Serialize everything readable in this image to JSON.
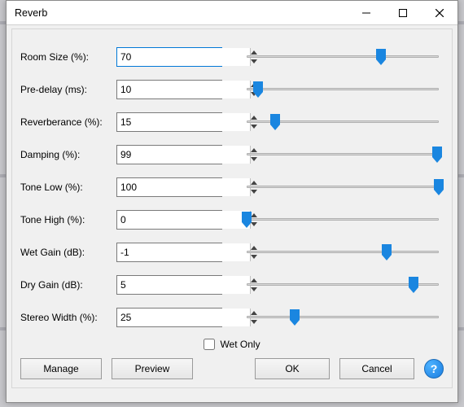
{
  "window": {
    "title": "Reverb"
  },
  "params": [
    {
      "key": "room_size",
      "label": "Room Size (%):",
      "value": "70",
      "pct": 70,
      "focus": true
    },
    {
      "key": "pre_delay",
      "label": "Pre-delay (ms):",
      "value": "10",
      "pct": 6
    },
    {
      "key": "reverberance",
      "label": "Reverberance (%):",
      "value": "15",
      "pct": 15
    },
    {
      "key": "damping",
      "label": "Damping (%):",
      "value": "99",
      "pct": 99
    },
    {
      "key": "tone_low",
      "label": "Tone Low (%):",
      "value": "100",
      "pct": 100
    },
    {
      "key": "tone_high",
      "label": "Tone High (%):",
      "value": "0",
      "pct": 0
    },
    {
      "key": "wet_gain",
      "label": "Wet Gain (dB):",
      "value": "-1",
      "pct": 73
    },
    {
      "key": "dry_gain",
      "label": "Dry Gain (dB):",
      "value": "5",
      "pct": 87
    },
    {
      "key": "stereo_width",
      "label": "Stereo Width (%):",
      "value": "25",
      "pct": 25
    }
  ],
  "wet_only": {
    "label": "Wet Only",
    "checked": false
  },
  "buttons": {
    "manage": "Manage",
    "preview": "Preview",
    "ok": "OK",
    "cancel": "Cancel",
    "help": "?"
  },
  "colors": {
    "accent": "#1a86e0"
  }
}
